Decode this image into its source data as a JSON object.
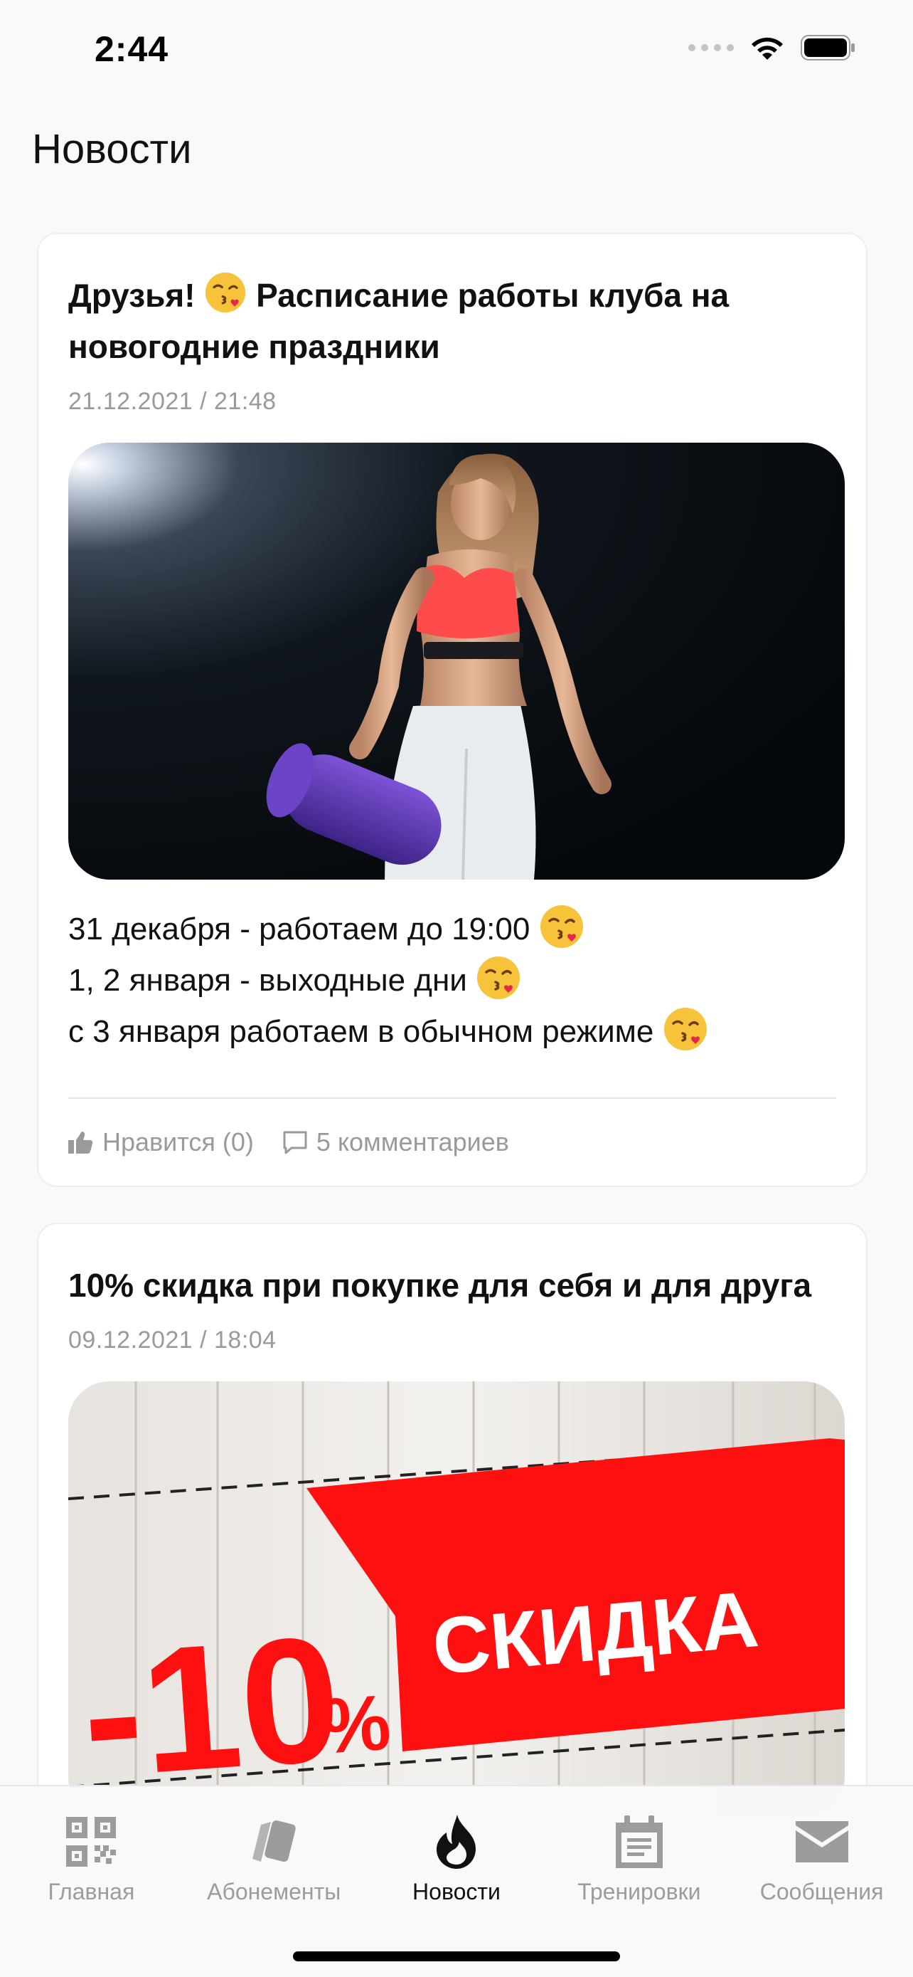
{
  "status_bar": {
    "time": "2:44"
  },
  "header": {
    "title": "Новости"
  },
  "feed": [
    {
      "title_part1": "Друзья!",
      "title_part2": "Расписание работы клуба на новогодние праздники",
      "date": "21.12.2021 / 21:48",
      "image": "fitness-woman-photo",
      "body_lines": [
        "31 декабря - работаем до 19:00",
        "1, 2 января - выходные дни",
        "с 3 января работаем в обычном режиме"
      ],
      "likes_label": "Нравится (0)",
      "comments_label": "5 комментариев"
    },
    {
      "title": "10% скидка при покупке для себя и для друга",
      "date": "09.12.2021 / 18:04",
      "image": "discount-banner",
      "banner_percent": "-10%",
      "banner_text": "СКИДКА"
    }
  ],
  "tab_bar": {
    "tabs": [
      {
        "label": "Главная",
        "icon": "qr-code-icon",
        "active": false
      },
      {
        "label": "Абонементы",
        "icon": "cards-icon",
        "active": false
      },
      {
        "label": "Новости",
        "icon": "flame-icon",
        "active": true
      },
      {
        "label": "Тренировки",
        "icon": "calendar-icon",
        "active": false
      },
      {
        "label": "Сообщения",
        "icon": "envelope-icon",
        "active": false
      }
    ]
  },
  "colors": {
    "accent_red": "#ff1010",
    "text": "#111111",
    "muted": "#9a9a9a"
  }
}
